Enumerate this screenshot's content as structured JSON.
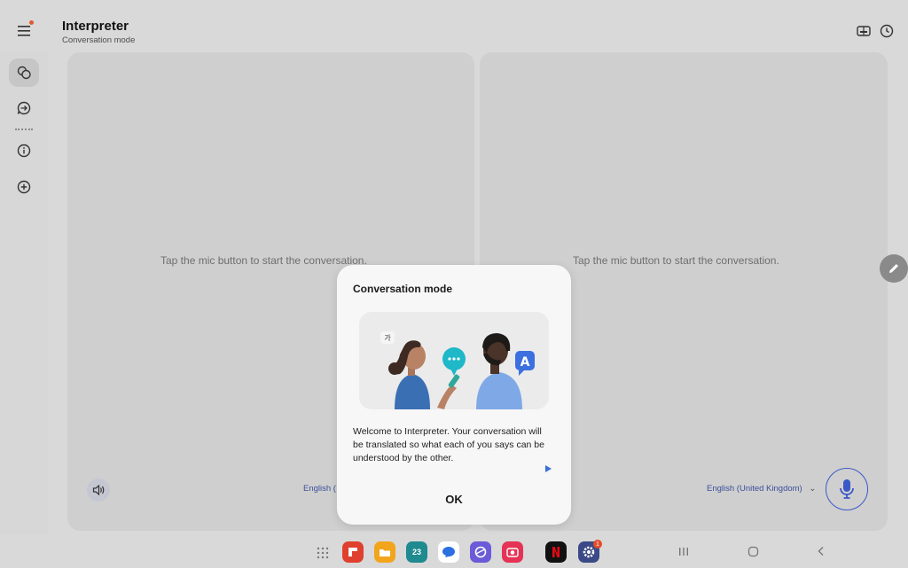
{
  "header": {
    "title": "Interpreter",
    "subtitle": "Conversation mode"
  },
  "rail": {
    "items": [
      {
        "name": "conversation-mode",
        "icon": "two-chat-bubbles-icon",
        "active": true
      },
      {
        "name": "listening-mode",
        "icon": "chat-arrow-icon",
        "active": false
      },
      {
        "name": "info",
        "icon": "info-icon",
        "active": false
      },
      {
        "name": "add",
        "icon": "add-circle-icon",
        "active": false
      }
    ]
  },
  "top_actions": [
    {
      "name": "face-to-face",
      "icon": "split-screen-icon"
    },
    {
      "name": "history",
      "icon": "clock-icon"
    }
  ],
  "panes": {
    "left_hint": "Tap the mic button to start the conversation.",
    "right_hint": "Tap the mic button to start the conversation.",
    "left_language": "English (",
    "right_language": "English (United Kingdom)"
  },
  "dialog": {
    "title": "Conversation mode",
    "body": "Welcome to Interpreter. Your conversation will be translated so what each of you says can be understood by the other.",
    "ok_label": "OK",
    "illustration": {
      "left_glyph": "가",
      "right_glyph": "A"
    }
  },
  "taskbar": {
    "calendar_day": "23",
    "settings_badge": "1",
    "apps": [
      "flipboard-icon",
      "files-icon",
      "calendar-icon",
      "messages-icon",
      "internet-icon",
      "screen-recorder-icon",
      "netflix-icon",
      "settings-icon"
    ]
  },
  "colors": {
    "accent": "#3b58c7",
    "notification_dot": "#e05a2c"
  }
}
